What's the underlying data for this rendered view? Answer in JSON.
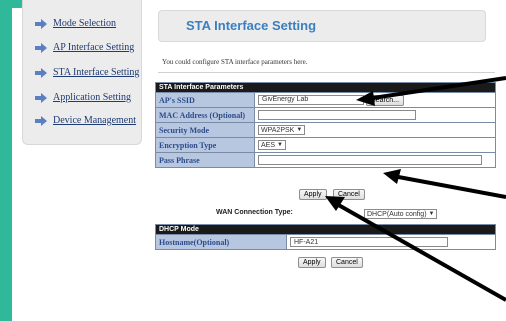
{
  "sidebar": {
    "items": [
      {
        "label": "Mode Selection"
      },
      {
        "label": "AP Interface Setting"
      },
      {
        "label": "STA Interface Setting"
      },
      {
        "label": "Application Setting"
      },
      {
        "label": "Device Management"
      }
    ]
  },
  "page": {
    "title": "STA Interface Setting",
    "description": "You could configure STA interface parameters here."
  },
  "sta_params": {
    "header": "STA Interface Parameters",
    "ssid_label": "AP's SSID",
    "ssid_value": "GivEnergy Lab",
    "search_label": "Search...",
    "mac_label": "MAC Address (Optional)",
    "mac_value": "",
    "security_label": "Security Mode",
    "security_value": "WPA2PSK",
    "encryption_label": "Encryption Type",
    "encryption_value": "AES",
    "pass_label": "Pass Phrase",
    "pass_value": "",
    "apply_label": "Apply",
    "cancel_label": "Cancel"
  },
  "wan": {
    "label": "WAN Connection Type:",
    "value": "DHCP(Auto config)"
  },
  "dhcp": {
    "header": "DHCP Mode",
    "hostname_label": "Hostname(Optional)",
    "hostname_value": "HF-A21",
    "apply_label": "Apply",
    "cancel_label": "Cancel"
  },
  "icons": {
    "nav": "arrow-right-icon",
    "dropdown": "chevron-down-icon"
  },
  "colors": {
    "frame": "#2fb89a",
    "title": "#3a7fc1",
    "label_bg": "#b8c7e0",
    "link": "#1f3b73"
  }
}
